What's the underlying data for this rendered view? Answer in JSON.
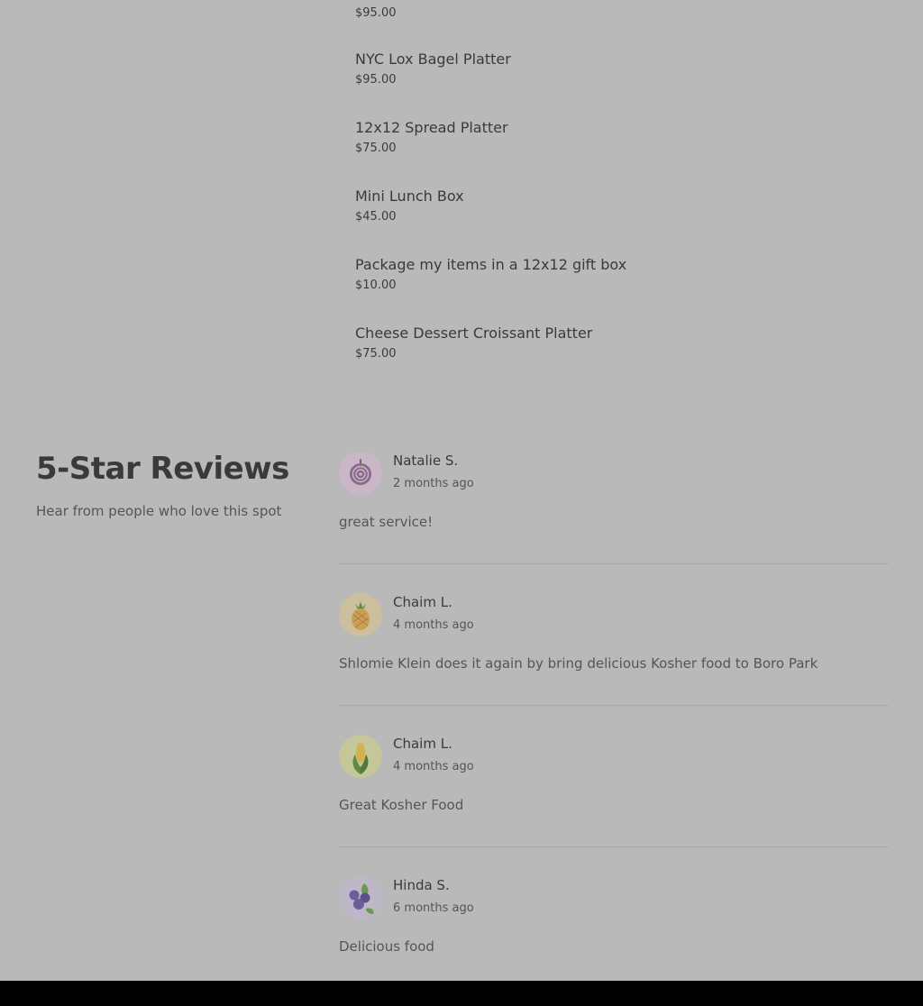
{
  "menu": {
    "top_price": "$95.00",
    "items": [
      {
        "name": "NYC Lox Bagel Platter",
        "price": "$95.00"
      },
      {
        "name": "12x12 Spread Platter",
        "price": "$75.00"
      },
      {
        "name": "Mini Lunch Box",
        "price": "$45.00"
      },
      {
        "name": "Package my items in a 12x12 gift box",
        "price": "$10.00"
      },
      {
        "name": "Cheese Dessert Croissant Platter",
        "price": "$75.00"
      }
    ]
  },
  "reviews": {
    "heading": "5-Star Reviews",
    "subheading": "Hear from people who love this spot",
    "list": [
      {
        "name": "Natalie S.",
        "time": "2 months ago",
        "text": "great service!",
        "avatar_icon": "onion-icon",
        "avatar_color": "#c9b6c7"
      },
      {
        "name": "Chaim L.",
        "time": "4 months ago",
        "text": "Shlomie Klein does it again by bring delicious Kosher food to Boro Park",
        "avatar_icon": "pineapple-icon",
        "avatar_color": "#cdbf9e"
      },
      {
        "name": "Chaim L.",
        "time": "4 months ago",
        "text": "Great Kosher Food",
        "avatar_icon": "corn-icon",
        "avatar_color": "#c5c69a"
      },
      {
        "name": "Hinda S.",
        "time": "6 months ago",
        "text": "Delicious food",
        "avatar_icon": "blueberries-icon",
        "avatar_color": "#bdb7c8"
      }
    ]
  }
}
